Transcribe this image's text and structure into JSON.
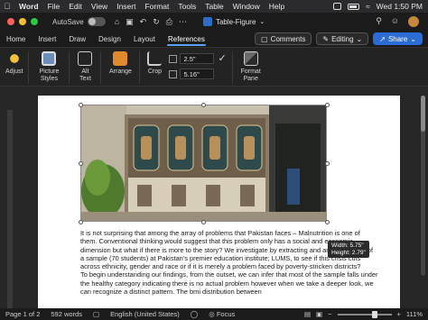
{
  "menubar": {
    "app": "Word",
    "items": [
      "File",
      "Edit",
      "View",
      "Insert",
      "Format",
      "Tools",
      "Table",
      "Window",
      "Help"
    ],
    "clock": "Wed 1:50 PM"
  },
  "titlebar": {
    "autosave_label": "AutoSave",
    "autosave_state": "OFF",
    "doc_title": "Table-Figure"
  },
  "tabs": {
    "items": [
      "Home",
      "Insert",
      "Draw",
      "Design",
      "Layout",
      "References"
    ],
    "active_index": 5,
    "comments_label": "Comments",
    "editing_label": "Editing",
    "share_label": "Share"
  },
  "ribbon": {
    "adjust": "Adjust",
    "picture_styles": "Picture Styles",
    "alt_text": "Alt Text",
    "arrange": "Arrange",
    "crop": "Crop",
    "height_value": "2.5\"",
    "width_value": "5.16\"",
    "format_pane": "Format Pane"
  },
  "document": {
    "size_tooltip": {
      "width": "Width: 5.75\"",
      "height": "Height: 2.79\""
    },
    "paragraphs": [
      "It is not surprising that among the array of problems that Pakistan faces – Malnutrition is one of them. Conventional thinking would suggest that this problem only has a social and economic dimension but what if there is more to the story? We investigate by extracting and analyzing data of a sample (70 students) at Pakistan's premier education institute; LUMS, to see if this crisis cuts across ethnicity, gender and race or if it is merely a problem faced by poverty-stricken districts?",
      "To begin understanding our findings, from the outset, we can infer that most of the sample falls under the healthy category indicating there is no actual problem however when we take a deeper look, we can recognize a distinct pattern. The bmi distribution between"
    ]
  },
  "statusbar": {
    "page": "Page 1 of 2",
    "words": "592 words",
    "language": "English (United States)",
    "focus": "Focus",
    "zoom": "111%"
  },
  "colors": {
    "accent": "#2b6cd6",
    "tab_underline": "#5aa1f2"
  }
}
